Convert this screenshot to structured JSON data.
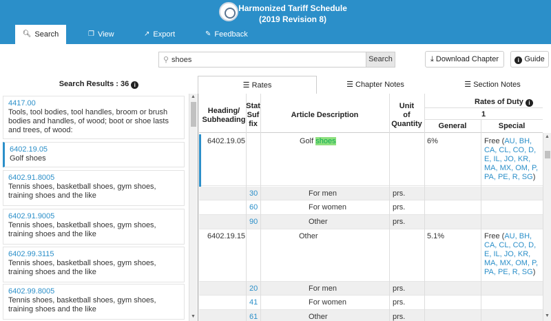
{
  "header": {
    "title_line1": "Harmonized Tariff Schedule",
    "title_line2": "(2019 Revision 8)",
    "tabs": [
      {
        "label": "Search"
      },
      {
        "label": "View"
      },
      {
        "label": "Export"
      },
      {
        "label": "Feedback"
      }
    ]
  },
  "search": {
    "value": "shoes",
    "button_label": "Search"
  },
  "actions": {
    "download_label": "Download Chapter",
    "guide_label": "Guide"
  },
  "results": {
    "heading": "Search Results : 36",
    "items": [
      {
        "code": "4417.00",
        "desc": "Tools, tool bodies, tool handles, broom or brush bodies and handles, of wood; boot or shoe lasts and trees, of wood:"
      },
      {
        "code": "6402.19.05",
        "desc": "Golf shoes"
      },
      {
        "code": "6402.91.8005",
        "desc": "Tennis shoes, basketball shoes, gym shoes, training shoes and the like"
      },
      {
        "code": "6402.91.9005",
        "desc": "Tennis shoes, basketball shoes, gym shoes, training shoes and the like"
      },
      {
        "code": "6402.99.3115",
        "desc": "Tennis shoes, basketball shoes, gym shoes, training shoes and the like"
      },
      {
        "code": "6402.99.8005",
        "desc": "Tennis shoes, basketball shoes, gym shoes, training shoes and the like"
      }
    ]
  },
  "content_tabs": [
    {
      "label": "Rates"
    },
    {
      "label": "Chapter Notes"
    },
    {
      "label": "Section Notes"
    }
  ],
  "table": {
    "headers": {
      "heading": "Heading/ Subheading",
      "stat1": "Stat",
      "stat2": "Suf",
      "stat3": "fix",
      "article": "Article Description",
      "unit1": "Unit",
      "unit2": "of",
      "unit3": "Quantity",
      "rates": "Rates of Duty",
      "col1": "1",
      "general": "General",
      "special": "Special"
    },
    "rows": [
      {
        "heading": "6402.19.05",
        "desc_pre": "Golf ",
        "desc_hl": "shoes",
        "general": "6%",
        "special_pre": "Free (",
        "special_codes": "AU, BH, CA, CL, CO, D, E, IL, JO, KR, MA, MX, OM, P, PA, PE, R, SG",
        "special_post": ")"
      },
      {
        "stat": "30",
        "desc": "For men",
        "unit": "prs."
      },
      {
        "stat": "60",
        "desc": "For women",
        "unit": "prs."
      },
      {
        "stat": "90",
        "desc": "Other",
        "unit": "prs."
      },
      {
        "heading": "6402.19.15",
        "desc": "Other",
        "general": "5.1%",
        "special_pre": "Free (",
        "special_codes": "AU, BH, CA, CL, CO, D, E, IL, JO, KR, MA, MX, OM, P, PA, PE, R, SG",
        "special_post": ")"
      },
      {
        "stat": "20",
        "desc": "For men",
        "unit": "prs."
      },
      {
        "stat": "41",
        "desc": "For women",
        "unit": "prs."
      },
      {
        "stat": "61",
        "desc": "Other",
        "unit": "prs."
      }
    ]
  },
  "colors": {
    "accent": "#2b8fc9",
    "highlight": "#8ee07e"
  }
}
